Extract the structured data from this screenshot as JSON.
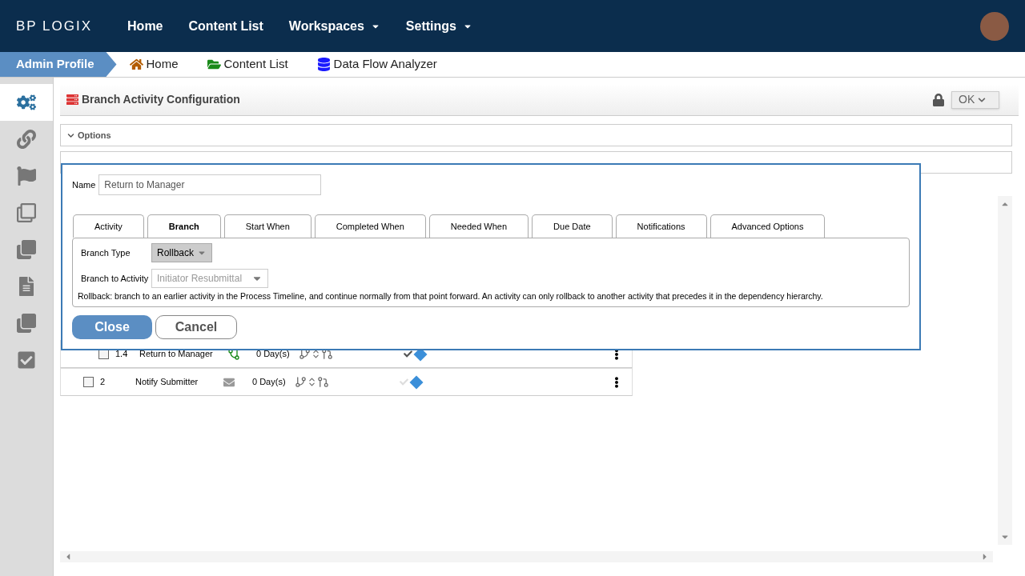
{
  "brand": "BP LOGIX",
  "nav": [
    {
      "label": "Home",
      "dropdown": false
    },
    {
      "label": "Content List",
      "dropdown": false
    },
    {
      "label": "Workspaces",
      "dropdown": true
    },
    {
      "label": "Settings",
      "dropdown": true
    }
  ],
  "breadcrumb": {
    "profile": "Admin Profile",
    "links": [
      {
        "label": "Home",
        "kind": "home"
      },
      {
        "label": "Content List",
        "kind": "folder"
      },
      {
        "label": "Data Flow Analyzer",
        "kind": "database"
      }
    ]
  },
  "sidebar": [
    {
      "kind": "gears",
      "selected": true
    },
    {
      "kind": "link",
      "selected": false
    },
    {
      "kind": "flag",
      "selected": false
    },
    {
      "kind": "squares",
      "selected": false
    },
    {
      "kind": "squares2",
      "selected": false
    },
    {
      "kind": "doclock",
      "selected": false
    },
    {
      "kind": "copy",
      "selected": false
    },
    {
      "kind": "checkdoc",
      "selected": false
    }
  ],
  "panel": {
    "title": "Branch Activity Configuration",
    "ok": "OK",
    "options": "Options"
  },
  "dialog": {
    "name_label": "Name",
    "name_value": "Return to Manager",
    "tabs": [
      {
        "label": "Activity",
        "selected": false
      },
      {
        "label": "Branch",
        "selected": true
      },
      {
        "label": "Start When",
        "selected": false
      },
      {
        "label": "Completed When",
        "selected": false
      },
      {
        "label": "Needed When",
        "selected": false
      },
      {
        "label": "Due Date",
        "selected": false
      },
      {
        "label": "Notifications",
        "selected": false
      },
      {
        "label": "Advanced Options",
        "selected": false
      }
    ],
    "branch_type_label": "Branch Type",
    "branch_type": "Rollback",
    "branch_to_label": "Branch to Activity",
    "branch_to": "Initiator Resubmittal",
    "branch_to_disabled": true,
    "help": "Rollback: branch to an earlier activity in the Process Timeline, and continue normally from that point forward. An activity can only rollback to another activity that precedes it in the dependency hierarchy.",
    "close": "Close",
    "cancel": "Cancel"
  },
  "rows": [
    {
      "number": "1.4",
      "name": "Return to Manager",
      "kind": "branch",
      "duration": "0 Day(s)",
      "checked": false,
      "confirmed": true,
      "nested": true
    },
    {
      "number": "2",
      "name": "Notify Submitter",
      "kind": "email",
      "duration": "0 Day(s)",
      "checked": false,
      "confirmed": false,
      "nested": false
    }
  ]
}
